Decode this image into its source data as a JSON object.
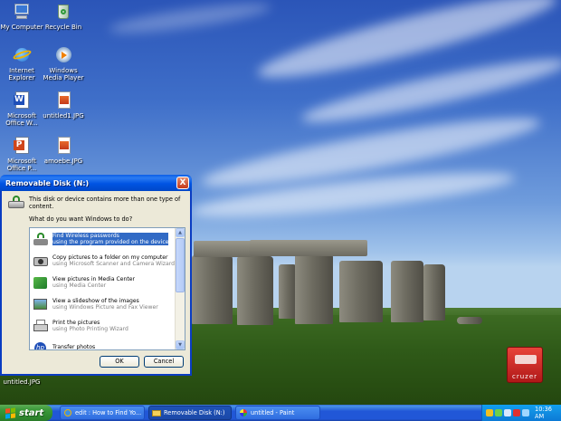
{
  "desktop": {
    "icons": [
      {
        "label": "My Computer",
        "icon": "my-computer-icon"
      },
      {
        "label": "Recycle Bin",
        "icon": "recycle-bin-icon"
      },
      {
        "label": "Internet Explorer",
        "icon": "internet-explorer-icon"
      },
      {
        "label": "Windows Media Player",
        "icon": "windows-media-player-icon"
      },
      {
        "label": "Microsoft Office W...",
        "icon": "word-document-icon"
      },
      {
        "label": "untitled1.JPG",
        "icon": "jpg-file-icon"
      },
      {
        "label": "Microsoft Office P...",
        "icon": "powerpoint-icon"
      },
      {
        "label": "amoebe.JPG",
        "icon": "jpg-file-icon"
      },
      {
        "label": "untitled.JPG",
        "icon": "jpg-file-icon"
      }
    ],
    "cruzer_logo": "cruzer"
  },
  "dialog": {
    "title": "Removable Disk (N:)",
    "message": "This disk or device contains more than one type of content.",
    "question": "What do you want Windows to do?",
    "options": [
      {
        "title": "Find Wireless passwords",
        "subtitle": "using the program provided on the device",
        "selected": true,
        "icon": "wireless-icon"
      },
      {
        "title": "Copy pictures to a folder on my computer",
        "subtitle": "using Microsoft Scanner and Camera Wizard",
        "selected": false,
        "icon": "camera-icon"
      },
      {
        "title": "View pictures in Media Center",
        "subtitle": "using Media Center",
        "selected": false,
        "icon": "media-center-icon"
      },
      {
        "title": "View a slideshow of the images",
        "subtitle": "using Windows Picture and Fax Viewer",
        "selected": false,
        "icon": "picture-viewer-icon"
      },
      {
        "title": "Print the pictures",
        "subtitle": "using Photo Printing Wizard",
        "selected": false,
        "icon": "printer-icon"
      },
      {
        "title": "Transfer photos",
        "subtitle": "",
        "selected": false,
        "icon": "hp-icon"
      }
    ],
    "ok_label": "OK",
    "cancel_label": "Cancel",
    "close_label": "X"
  },
  "taskbar": {
    "start_label": "start",
    "buttons": [
      {
        "label": "edit : How to Find Yo...",
        "icon": "internet-explorer-icon",
        "active": false
      },
      {
        "label": "Removable Disk (N:)",
        "icon": "folder-icon",
        "active": true
      },
      {
        "label": "untitled - Paint",
        "icon": "paint-icon",
        "active": false
      }
    ],
    "clock": "10:36 AM"
  },
  "colors": {
    "selection": "#316ac5",
    "title_bar": "#0054e3",
    "taskbar": "#2157d7",
    "start_button": "#3c9a3a",
    "tray": "#0f9ff0"
  }
}
